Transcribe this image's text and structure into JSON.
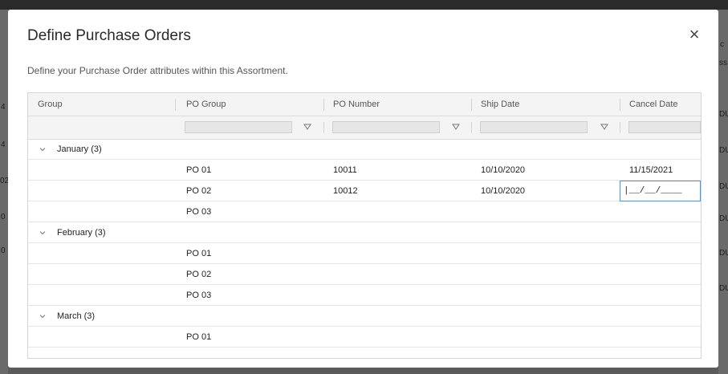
{
  "dialog": {
    "title": "Define Purchase Orders",
    "description": "Define your Purchase Order attributes within this Assortment.",
    "close_glyph": "×"
  },
  "grid": {
    "columns": [
      "Group",
      "PO Group",
      "PO Number",
      "Ship Date",
      "Cancel Date"
    ],
    "groups": [
      {
        "label": "January (3)",
        "rows": [
          {
            "po_group": "PO 01",
            "po_number": "10011",
            "ship_date": "10/10/2020",
            "cancel_date": "11/15/2021"
          },
          {
            "po_group": "PO 02",
            "po_number": "10012",
            "ship_date": "10/10/2020",
            "cancel_date_editing": "|__/__/____"
          },
          {
            "po_group": "PO 03"
          }
        ]
      },
      {
        "label": "February (3)",
        "rows": [
          {
            "po_group": "PO 01"
          },
          {
            "po_group": "PO 02"
          },
          {
            "po_group": "PO 03"
          }
        ]
      },
      {
        "label": "March (3)",
        "rows": [
          {
            "po_group": "PO 01"
          }
        ]
      }
    ]
  },
  "background_fragments": {
    "right": [
      "c",
      "ss",
      "DU",
      "DU",
      "DU",
      "DU",
      "DU",
      "DU"
    ],
    "left": [
      "4",
      "4",
      "02",
      "0",
      "0"
    ]
  },
  "icons": {
    "close": "close-icon",
    "chevron": "chevron-down-icon",
    "filter": "filter-icon"
  },
  "colors": {
    "focus_border": "#5f8fc4",
    "header_bg": "#f4f4f4"
  }
}
